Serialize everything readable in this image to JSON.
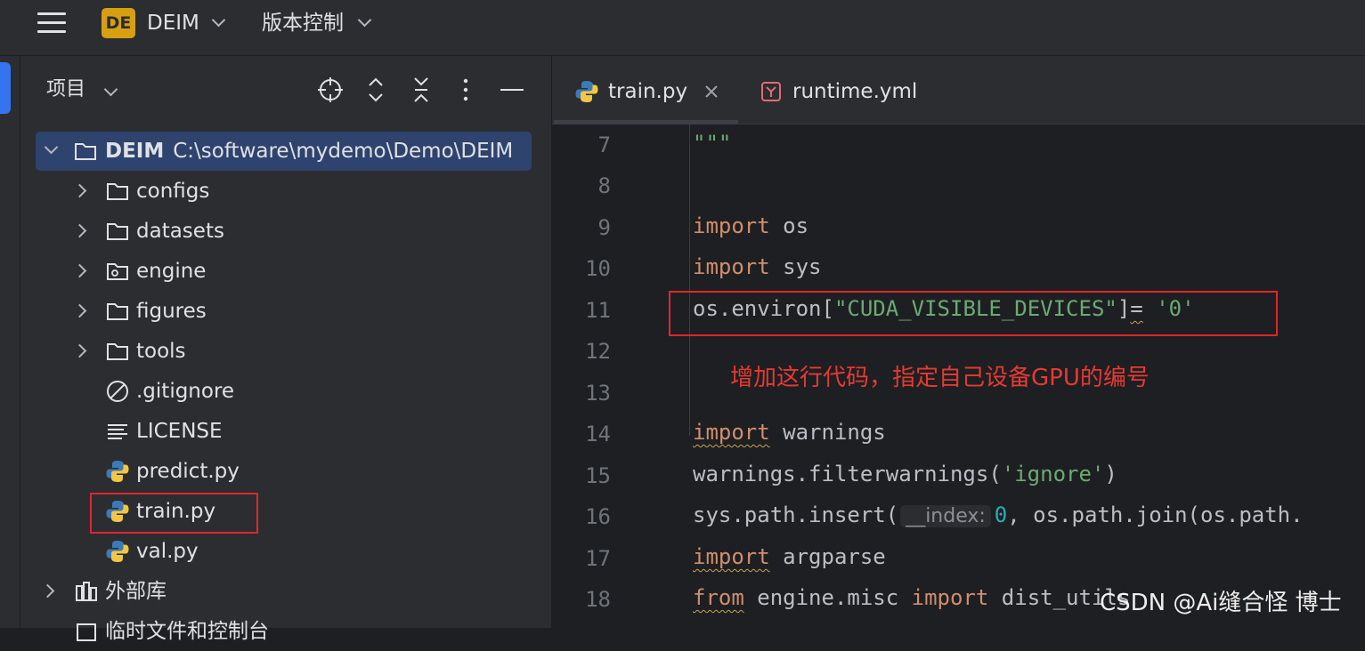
{
  "titlebar": {
    "project_badge": "DE",
    "project_name": "DEIM",
    "vcs_label": "版本控制"
  },
  "project_panel": {
    "title": "项目",
    "tools": [
      "locate-icon",
      "expand-all-icon",
      "collapse-all-icon",
      "more-icon",
      "hide-icon"
    ],
    "tree": [
      {
        "label": "DEIM",
        "path": "C:\\software\\mydemo\\Demo\\DEIM",
        "type": "folder",
        "expanded": true
      },
      {
        "label": "configs",
        "type": "folder"
      },
      {
        "label": "datasets",
        "type": "folder"
      },
      {
        "label": "engine",
        "type": "package-folder"
      },
      {
        "label": "figures",
        "type": "folder"
      },
      {
        "label": "tools",
        "type": "folder"
      },
      {
        "label": ".gitignore",
        "type": "ignore-file"
      },
      {
        "label": "LICENSE",
        "type": "text-file"
      },
      {
        "label": "predict.py",
        "type": "python-file"
      },
      {
        "label": "train.py",
        "type": "python-file"
      },
      {
        "label": "val.py",
        "type": "python-file"
      },
      {
        "label": "外部库",
        "type": "library"
      },
      {
        "label": "临时文件和控制台",
        "type": "scratches"
      }
    ]
  },
  "editor": {
    "tabs": [
      {
        "label": "train.py",
        "icon": "python-icon",
        "active": true
      },
      {
        "label": "runtime.yml",
        "icon": "yaml-icon",
        "active": false
      }
    ],
    "line_numbers": [
      "7",
      "8",
      "9",
      "10",
      "11",
      "12",
      "13",
      "14",
      "15",
      "16",
      "17",
      "18"
    ],
    "code": {
      "l7": "\"\"\"",
      "import": "import",
      "os": " os",
      "sys": " sys",
      "l11_a": "os.environ[",
      "l11_str": "\"CUDA_VISIBLE_DEVICES\"",
      "l11_b": "]",
      "l11_eq": "=",
      "l11_sp": " ",
      "l11_val": "'0'",
      "warnings": " warnings",
      "l15_a": "warnings.filterwarnings(",
      "l15_str": "'ignore'",
      "l15_b": ")",
      "l16_a": "sys.path.insert(",
      "l16_hint": "__index:",
      "l16_num": "0",
      "l16_b": ", os.path.join(os.path.",
      "argparse": " argparse",
      "from": "from",
      "l18_mod": " engine.misc ",
      "l18_rest": " dist_utils"
    },
    "annotation": "增加这行代码，指定自己设备GPU的编号"
  },
  "watermark": "CSDN @Ai缝合怪 博士",
  "colors": {
    "accent": "#3574f0",
    "badge": "#d6a012",
    "keyword": "#cf8e6d",
    "string": "#6aab73",
    "number": "#2aacb8",
    "highlight_box": "#e0262d"
  }
}
